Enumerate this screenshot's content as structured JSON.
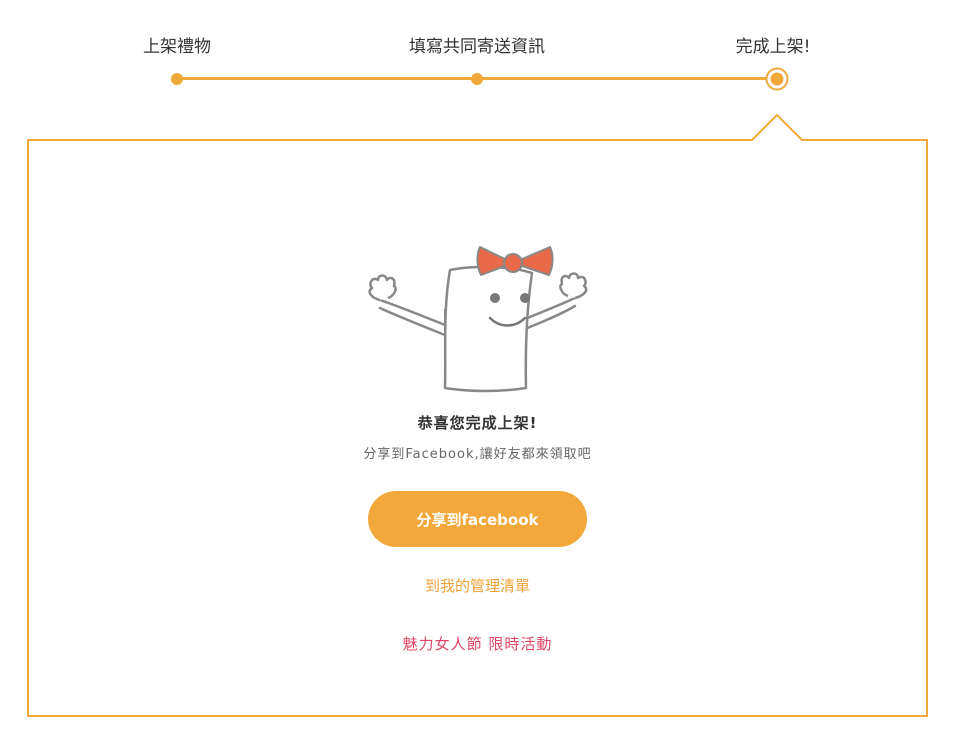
{
  "steps": {
    "items": [
      {
        "label": "上架禮物"
      },
      {
        "label": "填寫共同寄送資訊"
      },
      {
        "label": "完成上架!"
      }
    ],
    "current": 3
  },
  "result": {
    "title": "恭喜您完成上架!",
    "subtitle": "分享到Facebook,讓好友都來領取吧"
  },
  "actions": {
    "share_button": "分享到facebook",
    "manage_link": "到我的管理清單",
    "event_link": "魅力女人節 限時活動"
  },
  "colors": {
    "accent": "#f1a93a",
    "event_link": "#e04765",
    "bow": "#e86a48"
  }
}
